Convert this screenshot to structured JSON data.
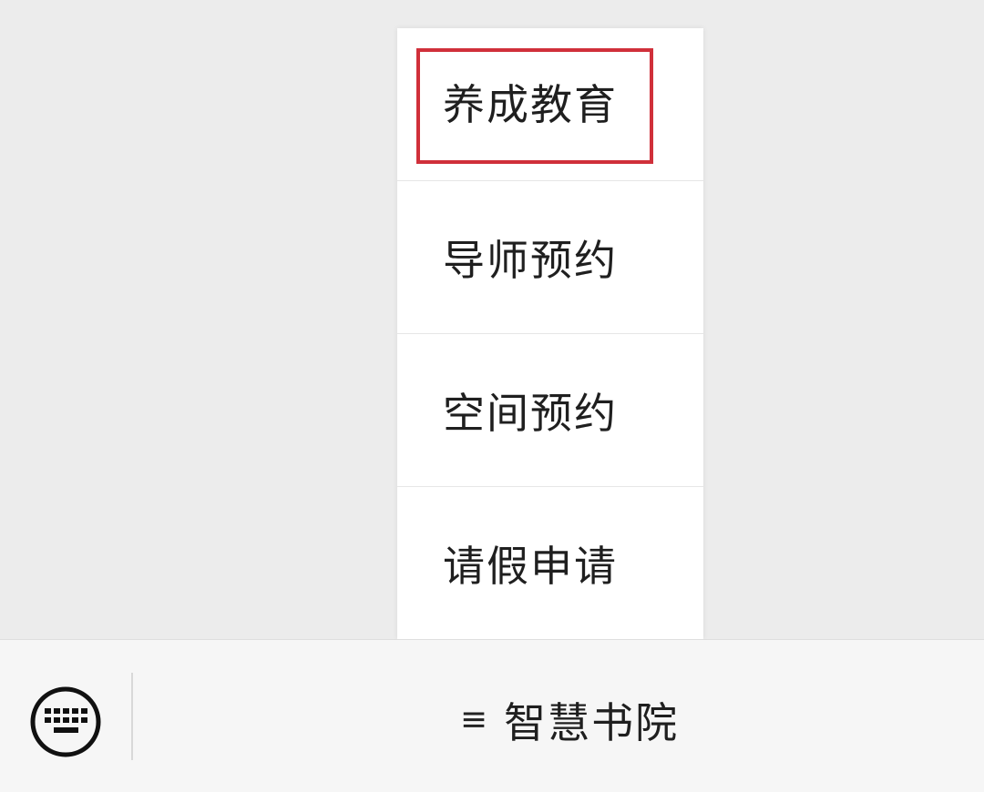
{
  "popup_menu": {
    "items": [
      {
        "label": "养成教育",
        "highlighted": true
      },
      {
        "label": "导师预约",
        "highlighted": false
      },
      {
        "label": "空间预约",
        "highlighted": false
      },
      {
        "label": "请假申请",
        "highlighted": false
      }
    ],
    "highlight_color": "#d0303a"
  },
  "bottom_bar": {
    "keyboard_icon": "keyboard-icon",
    "menu_button": {
      "icon": "hamburger-icon",
      "icon_glyph": "≡",
      "label": "智慧书院"
    }
  }
}
